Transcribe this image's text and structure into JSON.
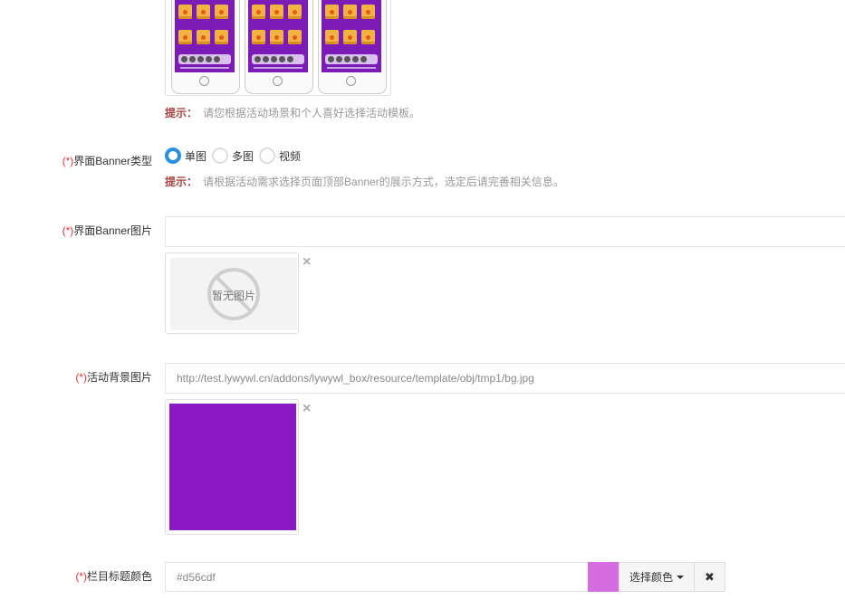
{
  "template_section": {
    "tip_label": "提示：",
    "tip_text": "请您根据活动场景和个人喜好选择活动模板。"
  },
  "banner_type": {
    "required_mark": "(*)",
    "label": "界面Banner类型",
    "options": [
      {
        "label": "单图",
        "selected": true
      },
      {
        "label": "多图",
        "selected": false
      },
      {
        "label": "视频",
        "selected": false
      }
    ],
    "tip_label": "提示：",
    "tip_text": "请根据活动需求选择页面顶部Banner的展示方式，选定后请完善相关信息。"
  },
  "banner_image": {
    "required_mark": "(*)",
    "label": "界面Banner图片",
    "value": "",
    "placeholder_text": "暂无图片",
    "remove_icon": "×"
  },
  "bg_image": {
    "required_mark": "(*)",
    "label": "活动背景图片",
    "value": "http://test.lywywl.cn/addons/lywywl_box/resource/template/obj/tmp1/bg.jpg",
    "preview_color": "#8a18c4",
    "remove_icon": "×"
  },
  "title_color": {
    "required_mark": "(*)",
    "label": "栏目标题颜色",
    "value": "#d56cdf",
    "swatch_color": "#d56cdf",
    "pick_label": "选择颜色",
    "clear_icon": "✖"
  },
  "colors": {
    "accent": "#2b8fe0",
    "required": "#e4393c",
    "tip_label": "#a94442"
  }
}
